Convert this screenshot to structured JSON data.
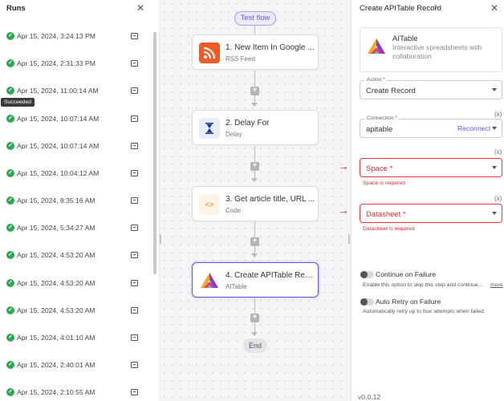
{
  "runs_panel": {
    "title": "Runs",
    "tooltip": "Succeeded",
    "runs": [
      {
        "time": "Apr 15, 2024, 3:24:13 PM"
      },
      {
        "time": "Apr 15, 2024, 2:31:33 PM"
      },
      {
        "time": "Apr 15, 2024, 11:00:14 AM"
      },
      {
        "time": "Apr 15, 2024, 10:07:14 AM"
      },
      {
        "time": "Apr 15, 2024, 10:07:14 AM"
      },
      {
        "time": "Apr 15, 2024, 10:04:12 AM"
      },
      {
        "time": "Apr 15, 2024, 8:35:16 AM"
      },
      {
        "time": "Apr 15, 2024, 5:34:27 AM"
      },
      {
        "time": "Apr 15, 2024, 4:53:20 AM"
      },
      {
        "time": "Apr 15, 2024, 4:53:20 AM"
      },
      {
        "time": "Apr 15, 2024, 4:53:20 AM"
      },
      {
        "time": "Apr 15, 2024, 4:01:10 AM"
      },
      {
        "time": "Apr 15, 2024, 2:40:01 AM"
      },
      {
        "time": "Apr 15, 2024, 2:10:55 AM"
      }
    ]
  },
  "flow": {
    "test_button": "Test flow",
    "end_label": "End",
    "steps": [
      {
        "title": "1. New Item In Google ...",
        "subtitle": "RSS Feed",
        "icon": "rss-icon"
      },
      {
        "title": "2. Delay For",
        "subtitle": "Delay",
        "icon": "hourglass-icon"
      },
      {
        "title": "3. Get article title, URL ...",
        "subtitle": "Code",
        "icon": "code-icon"
      },
      {
        "title": "4. Create APITable Rec...",
        "subtitle": "AITable",
        "icon": "aitable-logo-icon"
      }
    ]
  },
  "settings": {
    "title": "Create APITable Record",
    "app_name": "AITable",
    "app_description": "Interactive spreadsheets with collaboration",
    "action_label": "Action *",
    "action_value": "Create Record",
    "connection_label": "Connection *",
    "connection_value": "apitable",
    "reconnect": "Reconnect",
    "fx_symbol": "(x)",
    "space_placeholder": "Space *",
    "space_error": "Space is required",
    "datasheet_placeholder": "Datasheet *",
    "datasheet_error": "Datasheet is required",
    "continue_on_failure": "Continue on Failure",
    "continue_desc": "Enable this option to skip this step and continue...",
    "more_link": "more",
    "auto_retry": "Auto Retry on Failure",
    "auto_retry_desc": "Automatically retry up to four attempts when failed.",
    "version": "v0.0.12"
  },
  "colors": {
    "accent": "#6c4ee3",
    "success": "#2fa84f",
    "error": "#d42e31",
    "rss": "#f05a28"
  }
}
